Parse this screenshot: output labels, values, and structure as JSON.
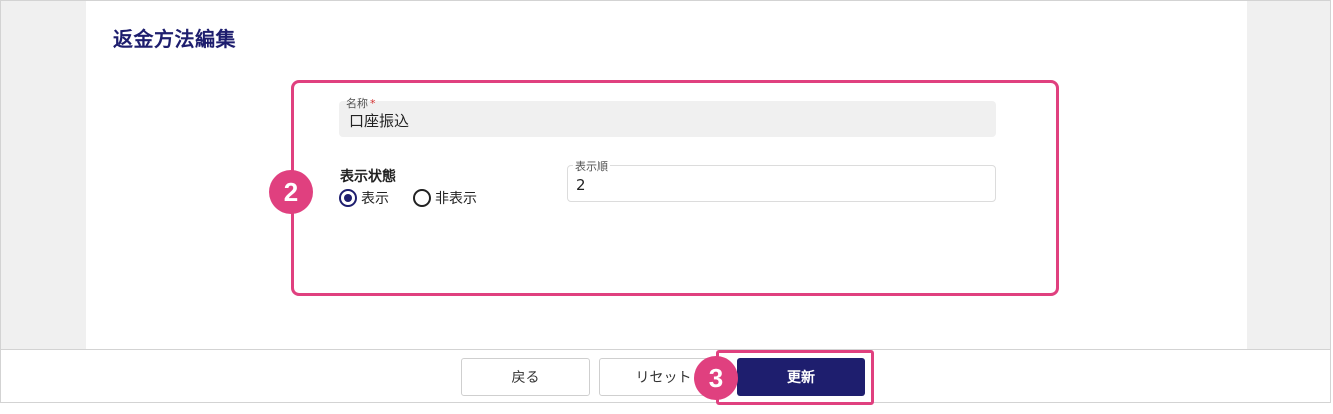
{
  "page": {
    "title": "返金方法編集"
  },
  "form": {
    "name": {
      "label": "名称",
      "required_mark": "*",
      "value": "口座振込"
    },
    "status": {
      "label": "表示状態",
      "options": [
        {
          "label": "表示",
          "checked": true
        },
        {
          "label": "非表示",
          "checked": false
        }
      ]
    },
    "display_order": {
      "label": "表示順",
      "value": "2"
    }
  },
  "footer": {
    "back_label": "戻る",
    "reset_label": "リセット",
    "update_label": "更新"
  },
  "annotations": {
    "step_2": "2",
    "step_3": "3"
  },
  "colors": {
    "accent": "#1e1e6e",
    "highlight": "#e0407f",
    "required": "#d32f2f"
  }
}
